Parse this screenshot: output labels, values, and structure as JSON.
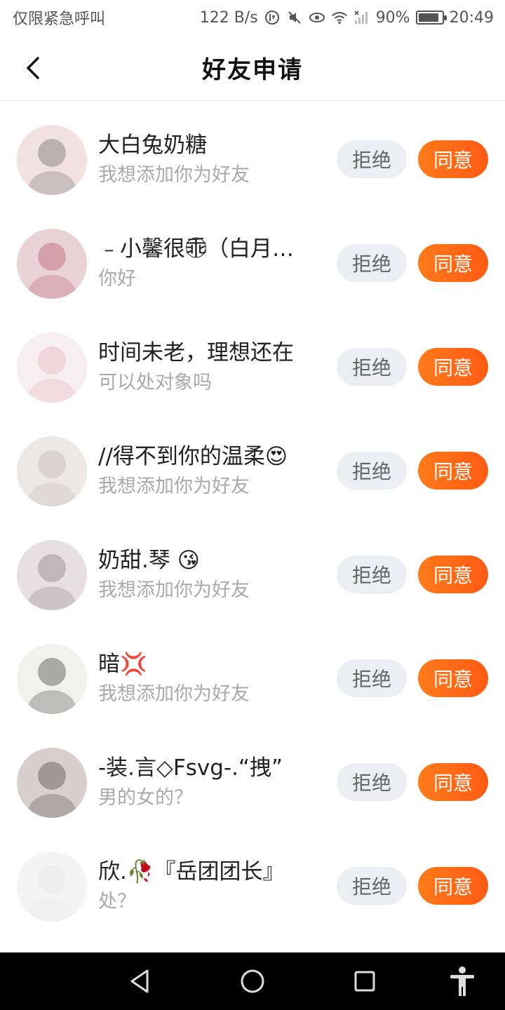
{
  "status_bar": {
    "carrier": "仅限紧急呼叫",
    "speed": "122 B/s",
    "battery": "90%",
    "battery_level": 0.9,
    "time": "20:49"
  },
  "header": {
    "title": "好友申请"
  },
  "requests": [
    {
      "name": "大白兔奶糖",
      "message": "我想添加你为好友",
      "avatar_colors": [
        "#f2e2e2",
        "#555555"
      ]
    },
    {
      "name": "﹣小馨很乖⃝（白月…",
      "message": "你好",
      "avatar_colors": [
        "#e9d2d8",
        "#b4465a"
      ]
    },
    {
      "name": "时间未老，理想还在",
      "message": "可以处对象吗",
      "avatar_colors": [
        "#f6eef0",
        "#e6a7b9"
      ]
    },
    {
      "name": "//得不到你的温柔😍",
      "message": "我想添加你为好友",
      "avatar_colors": [
        "#ece8e6",
        "#b9aea8"
      ]
    },
    {
      "name": "奶甜.琴 😘",
      "message": "我想添加你为好友",
      "avatar_colors": [
        "#e8dfe3",
        "#7d6a6f"
      ]
    },
    {
      "name": "暗💢",
      "message": "我想添加你为好友",
      "avatar_colors": [
        "#f1f1ee",
        "#222222"
      ]
    },
    {
      "name": "-装.言◇Fsvg-.“拽”",
      "message": "男的女的？",
      "avatar_colors": [
        "#d9cfcf",
        "#3a2e2e"
      ]
    },
    {
      "name": "欣.🥀『岳团团长』",
      "message": "处？",
      "avatar_colors": [
        "#f4f4f4",
        "#e2e2e2"
      ]
    }
  ],
  "buttons": {
    "reject": "拒绝",
    "accept": "同意"
  },
  "colors": {
    "accent": "#ff6a17",
    "reject_bg": "#eceef3"
  }
}
